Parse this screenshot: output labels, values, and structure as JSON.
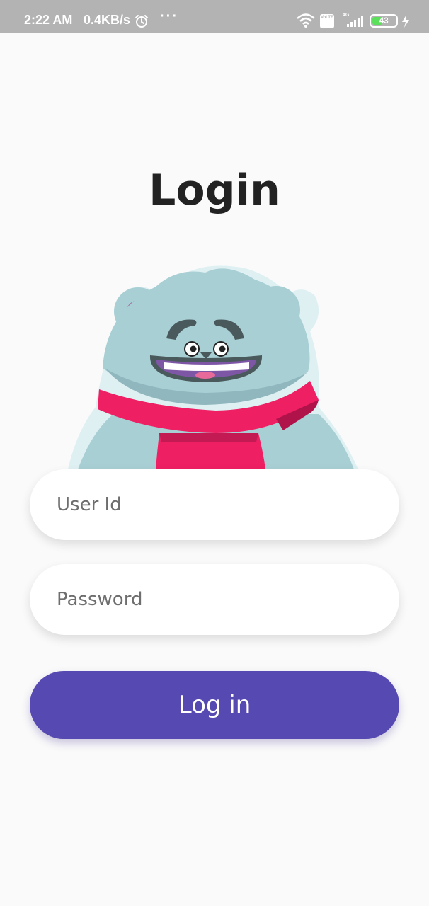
{
  "status_bar": {
    "time": "2:22 AM",
    "speed": "0.4KB/s",
    "more": "···",
    "volte": "VoLTE",
    "network": "4G",
    "battery": "43",
    "battery_level": 0.43,
    "icons": [
      "alarm-icon",
      "wifi-icon",
      "volte-icon",
      "signal-icon",
      "battery-icon",
      "charging-icon"
    ]
  },
  "page": {
    "title": "Login"
  },
  "form": {
    "user_id_placeholder": "User Id",
    "user_id_value": "",
    "password_placeholder": "Password",
    "password_value": "",
    "submit_label": "Log in"
  },
  "colors": {
    "accent": "#5649b1",
    "background": "#fafafa",
    "status_bar": "#b3b3b3",
    "mascot_fur": "#a8cfd4",
    "mascot_scarf": "#ee1f63"
  }
}
